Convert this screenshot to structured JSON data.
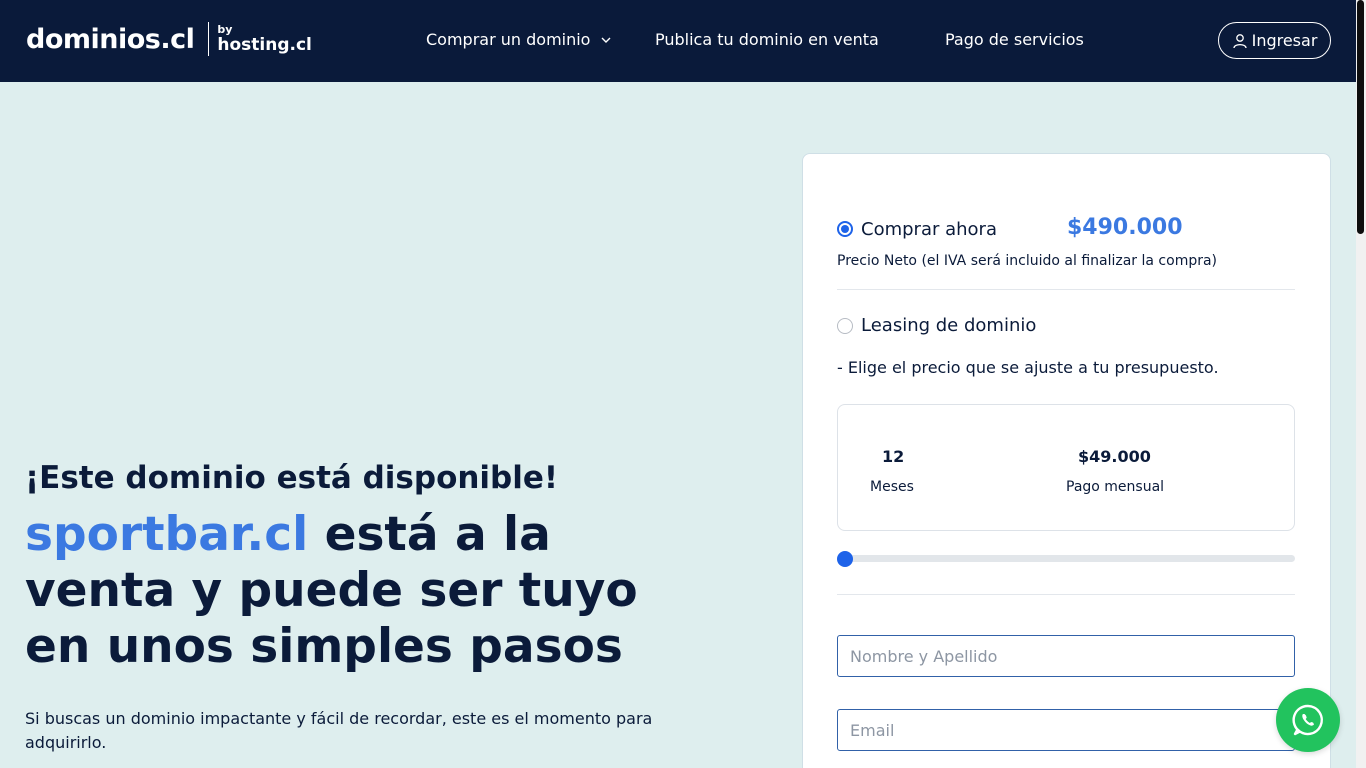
{
  "header": {
    "logo_main": "dominios.cl",
    "logo_by": "by",
    "logo_host": "hosting.cl",
    "nav": [
      {
        "label": "Comprar un dominio"
      },
      {
        "label": "Publica tu dominio en venta"
      },
      {
        "label": "Pago de servicios"
      }
    ],
    "login_label": "Ingresar"
  },
  "hero": {
    "subtitle": "¡Este dominio está disponible!",
    "domain": "sportbar.cl",
    "title_rest": " está a la venta y puede ser tuyo en unos simples pasos",
    "description": "Si buscas un dominio impactante y fácil de recordar, este es el momento para adquirirlo."
  },
  "purchase": {
    "buy_now_label": "Comprar ahora",
    "buy_now_price": "$490.000",
    "buy_now_selected": true,
    "price_note": "Precio Neto (el IVA será incluido al finalizar la compra)",
    "leasing_label": "Leasing de dominio",
    "leasing_selected": false,
    "leasing_note": "- Elige el precio que se ajuste a tu presupuesto.",
    "plan": {
      "months_value": "12",
      "months_label": "Meses",
      "monthly_value": "$49.000",
      "monthly_label": "Pago mensual"
    },
    "slider_fraction": 0
  },
  "form": {
    "name_placeholder": "Nombre y Apellido",
    "name_value": "",
    "email_placeholder": "Email",
    "email_value": ""
  },
  "icons": {
    "nav_dropdown": "chevron-down-icon",
    "login": "user-icon",
    "whatsapp": "whatsapp-icon"
  },
  "colors": {
    "header_bg": "#0a1a3a",
    "page_bg": "#deeeee",
    "accent": "#3b79e1",
    "radio_active": "#1e63e9",
    "whatsapp": "#22c35e"
  }
}
